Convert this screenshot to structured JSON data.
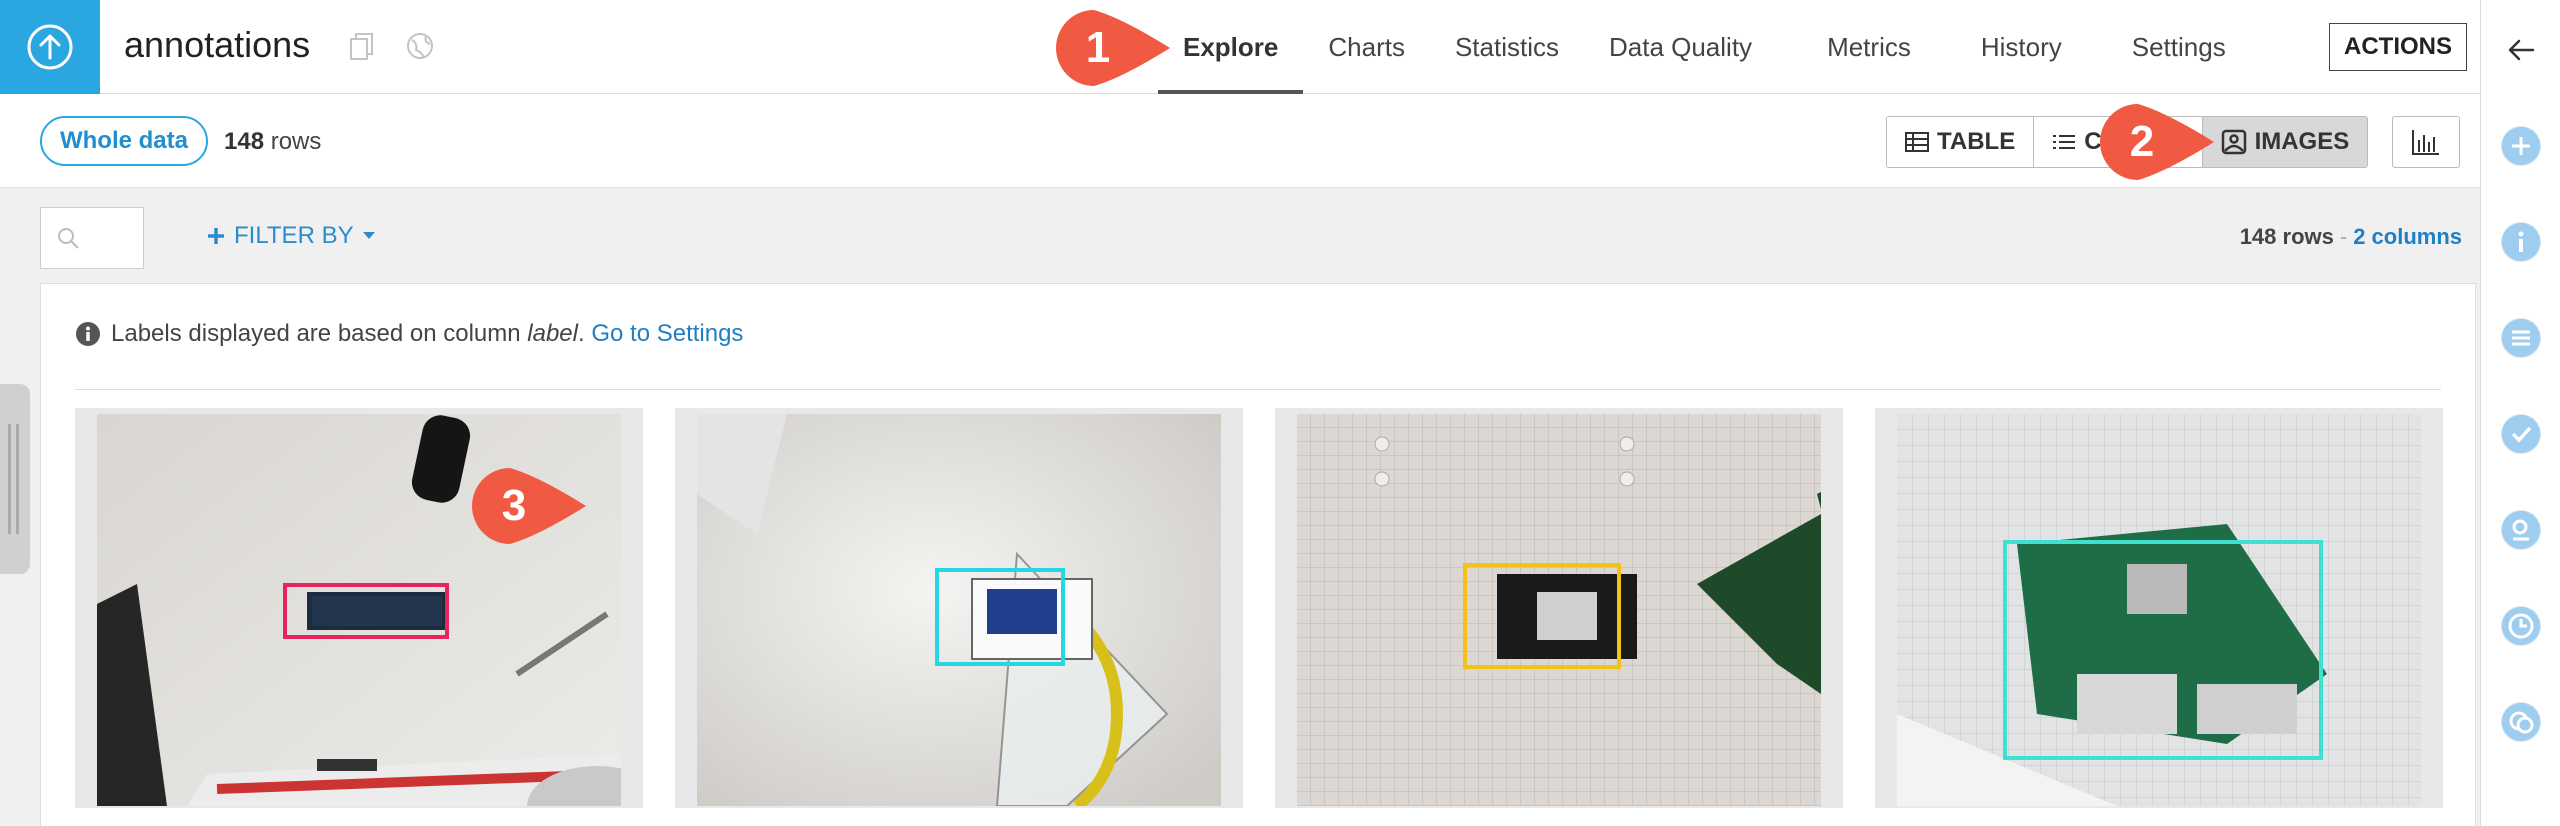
{
  "header": {
    "dataset_name": "annotations",
    "tabs": [
      {
        "label": "Explore",
        "active": true
      },
      {
        "label": "Charts",
        "active": false
      },
      {
        "label": "Statistics",
        "active": false
      },
      {
        "label": "Data Quality",
        "active": false
      },
      {
        "label": "Metrics",
        "active": false
      },
      {
        "label": "History",
        "active": false
      },
      {
        "label": "Settings",
        "active": false
      }
    ],
    "actions_label": "ACTIONS"
  },
  "subbar": {
    "sample_label": "Whole data",
    "rows_count": "148",
    "rows_word": "rows",
    "views": [
      {
        "label": "TABLE",
        "icon": "table-icon",
        "active": false
      },
      {
        "label": "C",
        "icon": "list-icon",
        "active": false
      },
      {
        "label": "IMAGES",
        "icon": "image-icon",
        "active": true
      }
    ]
  },
  "toolbar": {
    "filter_label": "FILTER BY",
    "rows_label": "148 rows",
    "columns_label": "2 columns"
  },
  "panel": {
    "info_prefix": "Labels displayed are based on column",
    "info_column": "label",
    "info_suffix": ".",
    "info_link": "Go to Settings"
  },
  "images": [
    {
      "bbox_color": "#e8245c",
      "subject": "microcontroller board on white desk"
    },
    {
      "bbox_color": "#26d6e0",
      "subject": "display board next to protractor"
    },
    {
      "bbox_color": "#f2c315",
      "subject": "wifi module on grid paper"
    },
    {
      "bbox_color": "#3ee0cf",
      "subject": "raspberry pi on grid paper"
    }
  ],
  "callouts": [
    {
      "number": "1",
      "color": "#f05a43"
    },
    {
      "number": "2",
      "color": "#f05a43"
    },
    {
      "number": "3",
      "color": "#f05a43"
    }
  ]
}
